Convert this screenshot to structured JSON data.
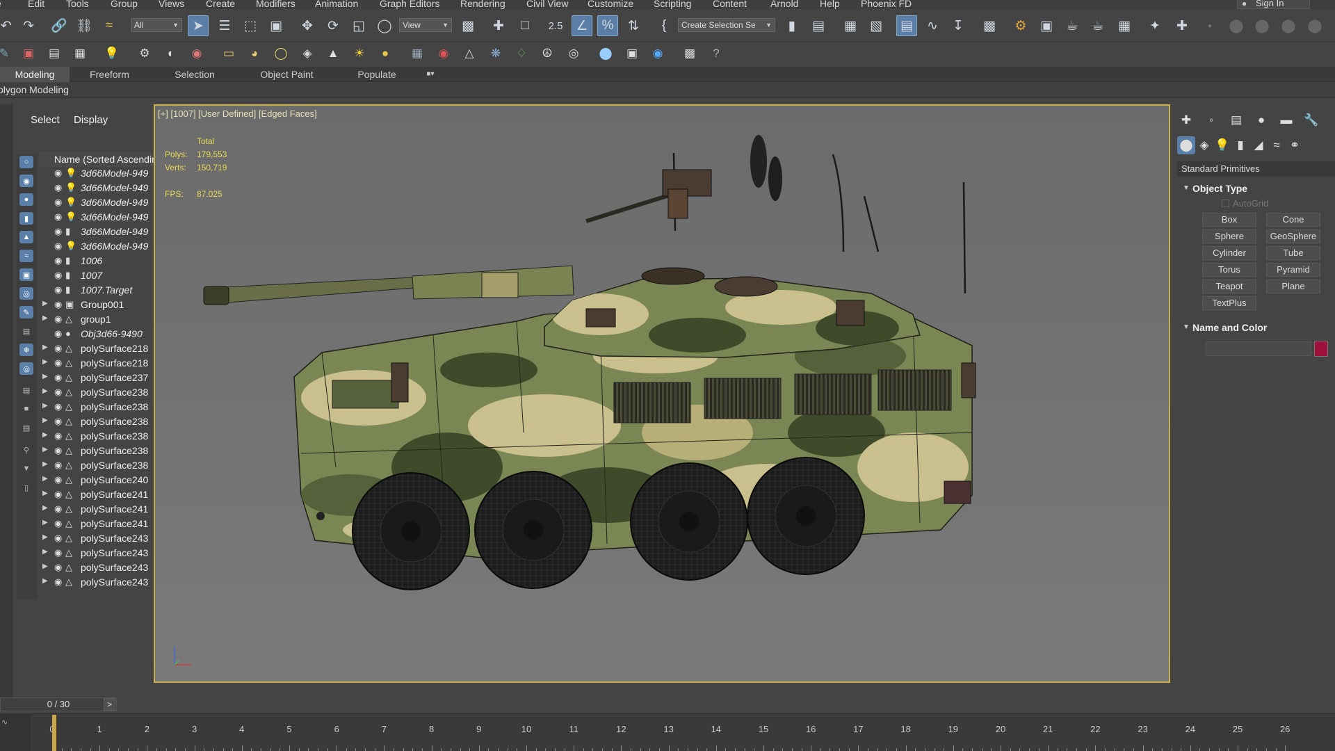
{
  "menu": [
    "Edit",
    "Tools",
    "Group",
    "Views",
    "Create",
    "Modifiers",
    "Animation",
    "Graph Editors",
    "Rendering",
    "Civil View",
    "Customize",
    "Scripting",
    "Content",
    "Arnold",
    "Help",
    "Phoenix FD"
  ],
  "menu_partial_first": "e",
  "sign_in": "Sign In",
  "toolbar": {
    "filter_select": "All",
    "view_select": "View",
    "angle_snap_label": "2.5",
    "selection_set": "Create Selection Se"
  },
  "ribbon_tabs": [
    "Modeling",
    "Freeform",
    "Selection",
    "Object Paint",
    "Populate"
  ],
  "ribbon_sub": "olygon Modeling",
  "explorer": {
    "menu": [
      "Select",
      "Display"
    ],
    "column_header": "Name (Sorted Ascending)",
    "rows": [
      {
        "name": "3d66Model-949",
        "type": "light",
        "italic": true,
        "expand": false
      },
      {
        "name": "3d66Model-949",
        "type": "light",
        "italic": true,
        "expand": false
      },
      {
        "name": "3d66Model-949",
        "type": "light",
        "italic": true,
        "expand": false
      },
      {
        "name": "3d66Model-949",
        "type": "light",
        "italic": true,
        "expand": false
      },
      {
        "name": "3d66Model-949",
        "type": "camera",
        "italic": true,
        "expand": false
      },
      {
        "name": "3d66Model-949",
        "type": "light",
        "italic": true,
        "expand": false
      },
      {
        "name": "1006",
        "type": "camera",
        "italic": true,
        "expand": false
      },
      {
        "name": "1007",
        "type": "camera",
        "italic": true,
        "expand": false
      },
      {
        "name": "1007.Target",
        "type": "camera",
        "italic": true,
        "expand": false
      },
      {
        "name": "Group001",
        "type": "group",
        "italic": false,
        "expand": true
      },
      {
        "name": "group1",
        "type": "mesh",
        "italic": false,
        "expand": true
      },
      {
        "name": "Obj3d66-9490",
        "type": "sphere",
        "italic": true,
        "expand": false
      },
      {
        "name": "polySurface218",
        "type": "mesh",
        "italic": false,
        "expand": true
      },
      {
        "name": "polySurface218",
        "type": "mesh",
        "italic": false,
        "expand": true
      },
      {
        "name": "polySurface237",
        "type": "mesh",
        "italic": false,
        "expand": true
      },
      {
        "name": "polySurface238",
        "type": "mesh",
        "italic": false,
        "expand": true
      },
      {
        "name": "polySurface238",
        "type": "mesh",
        "italic": false,
        "expand": true
      },
      {
        "name": "polySurface238",
        "type": "mesh",
        "italic": false,
        "expand": true
      },
      {
        "name": "polySurface238",
        "type": "mesh",
        "italic": false,
        "expand": true
      },
      {
        "name": "polySurface238",
        "type": "mesh",
        "italic": false,
        "expand": true
      },
      {
        "name": "polySurface238",
        "type": "mesh",
        "italic": false,
        "expand": true
      },
      {
        "name": "polySurface240",
        "type": "mesh",
        "italic": false,
        "expand": true
      },
      {
        "name": "polySurface241",
        "type": "mesh",
        "italic": false,
        "expand": true
      },
      {
        "name": "polySurface241",
        "type": "mesh",
        "italic": false,
        "expand": true
      },
      {
        "name": "polySurface241",
        "type": "mesh",
        "italic": false,
        "expand": true
      },
      {
        "name": "polySurface243",
        "type": "mesh",
        "italic": false,
        "expand": true
      },
      {
        "name": "polySurface243",
        "type": "mesh",
        "italic": false,
        "expand": true
      },
      {
        "name": "polySurface243",
        "type": "mesh",
        "italic": false,
        "expand": true
      },
      {
        "name": "polySurface243",
        "type": "mesh",
        "italic": false,
        "expand": true
      }
    ]
  },
  "viewport": {
    "label": "[+] [1007] [User Defined] [Edged Faces]",
    "stats_header": "Total",
    "stats": [
      {
        "label": "Polys:",
        "value": "179,553"
      },
      {
        "label": "Verts:",
        "value": "150,719"
      }
    ],
    "fps_label": "FPS:",
    "fps_value": "87.025",
    "border_color": "#c7b24a"
  },
  "command_panel": {
    "category": "Standard Primitives",
    "object_type_title": "Object Type",
    "autogrid": "AutoGrid",
    "buttons": [
      "Box",
      "Cone",
      "Sphere",
      "GeoSphere",
      "Cylinder",
      "Tube",
      "Torus",
      "Pyramid",
      "Teapot",
      "Plane",
      "TextPlus"
    ],
    "name_color_title": "Name and Color",
    "object_color": "#a0103c"
  },
  "timeline": {
    "frame_counter": "0 / 30",
    "next_label": ">",
    "ticks": [
      "0",
      "1",
      "2",
      "3",
      "4",
      "5",
      "6",
      "7",
      "8",
      "9",
      "10",
      "11",
      "12",
      "13",
      "14",
      "15",
      "16",
      "17",
      "18",
      "19",
      "20",
      "21",
      "22",
      "23",
      "24",
      "25",
      "26"
    ],
    "current_frame": 0
  },
  "colors": {
    "accent": "#5a7fa8",
    "camo_light": "#c9c08d",
    "camo_mid": "#7a8654",
    "camo_dark": "#3f4a2a"
  }
}
